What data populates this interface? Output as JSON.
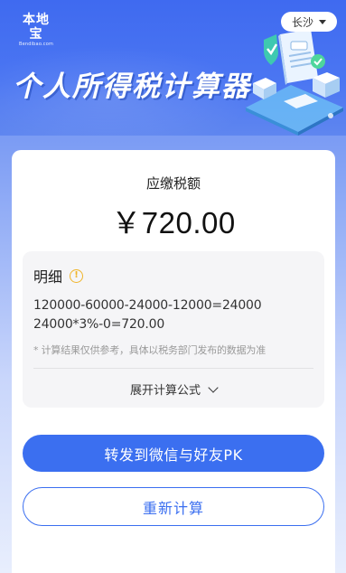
{
  "header": {
    "logo_text": "本地宝",
    "logo_sub": "Bendibao.com",
    "title": "个人所得税计算器",
    "city": "长沙"
  },
  "result": {
    "label": "应缴税额",
    "amount": "￥720.00"
  },
  "detail": {
    "heading": "明细",
    "info_glyph": "!",
    "formula_line1": "120000-60000-24000-12000=24000",
    "formula_line2": "24000*3%-0=720.00",
    "note": "* 计算结果仅供参考，具体以税务部门发布的数据为准",
    "expand_label": "展开计算公式"
  },
  "actions": {
    "share_label": "转发到微信与好友PK",
    "recalc_label": "重新计算"
  },
  "colors": {
    "accent": "#3b6ff0",
    "banner": "#3f6af0",
    "info": "#f0b429"
  },
  "icons": [
    "info-icon",
    "chevron-down-icon",
    "dropdown-caret-icon"
  ]
}
